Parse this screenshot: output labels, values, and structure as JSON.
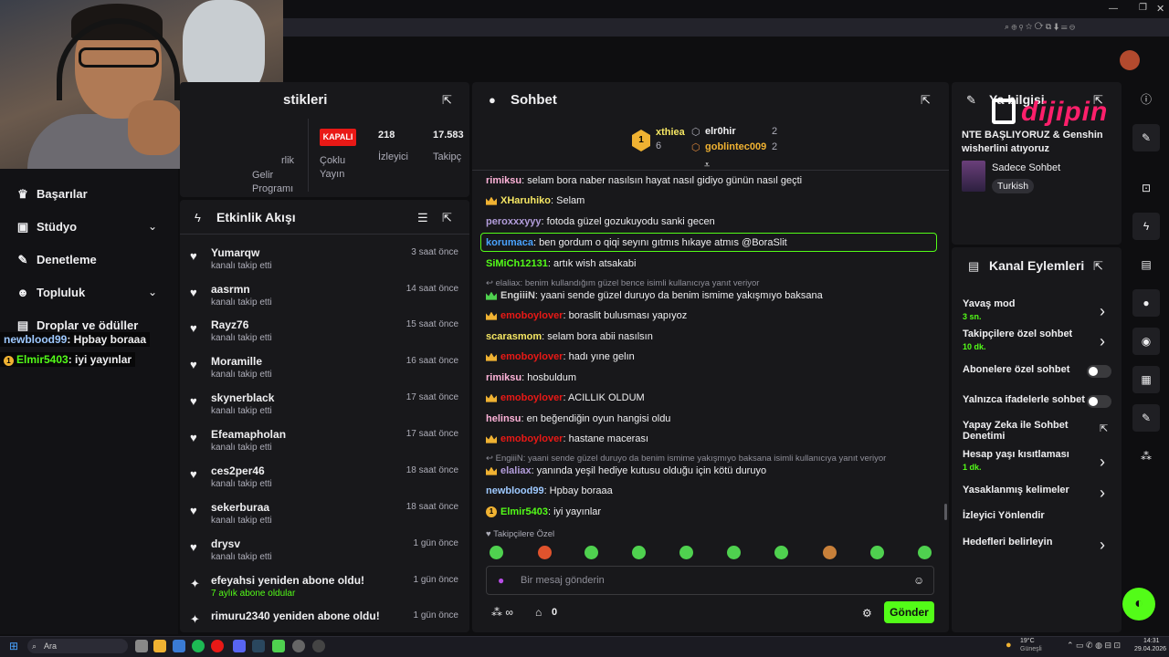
{
  "window": {
    "title_hint": ""
  },
  "overlay": {
    "logo_text": "dijipin",
    "chat": [
      {
        "user": "newblood99",
        "text": ": Hpbay boraaa"
      },
      {
        "user": "Elmir5403",
        "text": ": iyi yayınlar",
        "badge": "1"
      }
    ]
  },
  "sidebar": {
    "items": [
      {
        "label": "Başarılar"
      },
      {
        "label": "Stüdyo"
      },
      {
        "label": "Denetleme"
      },
      {
        "label": "Topluluk"
      },
      {
        "label": "Droplar ve ödüller"
      }
    ]
  },
  "stats": {
    "title_partial": "stikleri",
    "cols": [
      {
        "label": "rlik",
        "sub": "Gelir Programı"
      },
      {
        "badge": "KAPALI",
        "label": "Çoklu Yayın"
      },
      {
        "value": "218",
        "label": "İzleyici"
      },
      {
        "value": "17.583",
        "label": "Takipç"
      }
    ]
  },
  "activity": {
    "title": "Etkinlik Akışı",
    "events": [
      {
        "name": "Yumarqw",
        "sub": "kanalı takip etti",
        "time": "3 saat önce",
        "icon": "heart"
      },
      {
        "name": "aasrmn",
        "sub": "kanalı takip etti",
        "time": "14 saat önce",
        "icon": "heart"
      },
      {
        "name": "Rayz76",
        "sub": "kanalı takip etti",
        "time": "15 saat önce",
        "icon": "heart"
      },
      {
        "name": "Moramille",
        "sub": "kanalı takip etti",
        "time": "16 saat önce",
        "icon": "heart"
      },
      {
        "name": "skynerblack",
        "sub": "kanalı takip etti",
        "time": "17 saat önce",
        "icon": "heart"
      },
      {
        "name": "Efeamapholan",
        "sub": "kanalı takip etti",
        "time": "17 saat önce",
        "icon": "heart"
      },
      {
        "name": "ces2per46",
        "sub": "kanalı takip etti",
        "time": "18 saat önce",
        "icon": "heart"
      },
      {
        "name": "sekerburaa",
        "sub": "kanalı takip etti",
        "time": "18 saat önce",
        "icon": "heart"
      },
      {
        "name": "drysv",
        "sub": "kanalı takip etti",
        "time": "1 gün önce",
        "icon": "heart"
      },
      {
        "name": "efeyahsi yeniden abone oldu!",
        "sub": "7 aylık abone oldular",
        "time": "1 gün önce",
        "icon": "sparkle"
      },
      {
        "name": "rimuru2340 yeniden abone oldu!",
        "sub": "",
        "time": "1 gün önce",
        "icon": "sparkle"
      }
    ]
  },
  "chat": {
    "title": "Sohbet",
    "leaders": [
      {
        "name": "xthiea",
        "count": "6",
        "rank": "1"
      },
      {
        "name": "elr0hir",
        "count": "2"
      },
      {
        "name": "goblintec009",
        "count": "2"
      }
    ],
    "messages": [
      {
        "user": "rimiksu",
        "text": ": selam bora naber nasılsın hayat nasıl gidiyo günün nasıl geçti",
        "color": "#ffb3d9",
        "badge": false
      },
      {
        "user": "XHaruhiko",
        "text": ": Selam",
        "color": "#f5e663",
        "badge": true
      },
      {
        "user": "peroxxxyyy",
        "text": ": fotoda güzel gozukuyodu sanki gecen",
        "color": "#b39ddb",
        "badge": false
      },
      {
        "user": "korumaca",
        "text": ": ben gordum o qiqi seyını gıtmıs hıkaye atmıs @BoraSlit",
        "color": "#4aa3ff",
        "badge": false,
        "highlight": true
      },
      {
        "user": "SiMiCh12131",
        "text": ": artık wish atsakabi",
        "color": "#53fc18",
        "badge": false
      },
      {
        "reply": "elaliax: benim kullandığım güzel bence isimli kullanıcıya yanıt veriyor"
      },
      {
        "user": "EngiiiN",
        "text": ": yaani sende güzel duruyo da benim ismime yakışmıyo baksana",
        "color": "#d0d0d0",
        "badge": true,
        "badge_color": "#4fd14f"
      },
      {
        "user": "emoboylover",
        "text": ": boraslit bulusması yapıyoz",
        "color": "#e91916",
        "badge": true
      },
      {
        "user": "scarasmom",
        "text": ": selam bora abii nasılsın",
        "color": "#f5e663",
        "badge": false
      },
      {
        "user": "emoboylover",
        "text": ": hadı yıne gelın",
        "color": "#e91916",
        "badge": true
      },
      {
        "user": "rimiksu",
        "text": ": hosbuldum",
        "color": "#ffb3d9",
        "badge": false
      },
      {
        "user": "emoboylover",
        "text": ": ACILLIK OLDUM",
        "color": "#e91916",
        "badge": true
      },
      {
        "user": "helinsu",
        "text": ": en beğendiğin oyun hangisi oldu",
        "color": "#ffb3d9",
        "badge": false
      },
      {
        "user": "emoboylover",
        "text": ": hastane macerası",
        "color": "#e91916",
        "badge": true
      },
      {
        "reply": "EngiiiN: yaani sende güzel duruyo da benim ismime yakışmıyo baksana isimli kullanıcıya yanıt veriyor"
      },
      {
        "user": "elaliax",
        "text": ": yanında yeşil hediye kutusu olduğu için kötü duruyo",
        "color": "#b39ddb",
        "badge": true
      },
      {
        "user": "newblood99",
        "text": ": Hpbay boraaa",
        "color": "#9ec9ff",
        "badge": false
      },
      {
        "user": "Elmir5403",
        "text": ": iyi yayınlar",
        "color": "#53fc18",
        "badge": true,
        "badge_num": "1"
      }
    ],
    "followers_only_label": "Takipçilere Özel",
    "input_placeholder": "Bir mesaj gönderin",
    "points": "0",
    "send_label": "Gönder"
  },
  "stream_info": {
    "title_partial": "Ya bilgisi",
    "stream_title": "NTE BAŞLIYORUZ & Genshin wisherlini atıyoruz",
    "category": "Sadece Sohbet",
    "language": "Turkish"
  },
  "channel_actions": {
    "title": "Kanal Eylemleri",
    "items": [
      {
        "label": "Yavaş mod",
        "sub": "3 sn.",
        "control": "arrow"
      },
      {
        "label": "Takipçilere özel sohbet",
        "sub": "10 dk.",
        "control": "arrow"
      },
      {
        "label": "Abonelere özel sohbet",
        "control": "toggle"
      },
      {
        "label": "Yalnızca ifadelerle sohbet",
        "control": "toggle"
      },
      {
        "label": "Yapay Zeka ile Sohbet Denetimi",
        "control": "external"
      },
      {
        "label": "Hesap yaşı kısıtlaması",
        "sub": "1 dk.",
        "control": "arrow"
      },
      {
        "label": "Yasaklanmış kelimeler",
        "control": "arrow"
      },
      {
        "label": "İzleyici Yönlendir",
        "control": "none"
      },
      {
        "label": "Hedefleri belirleyin",
        "control": "arrow"
      }
    ]
  },
  "taskbar": {
    "search_placeholder": "Ara",
    "weather": "19°C",
    "weather_sub": "Güneşli",
    "time": "14:31",
    "date": "29.04.2026"
  },
  "colors": {
    "accent": "#53fc18",
    "panel": "#18181b",
    "bg": "#0e0e10"
  }
}
